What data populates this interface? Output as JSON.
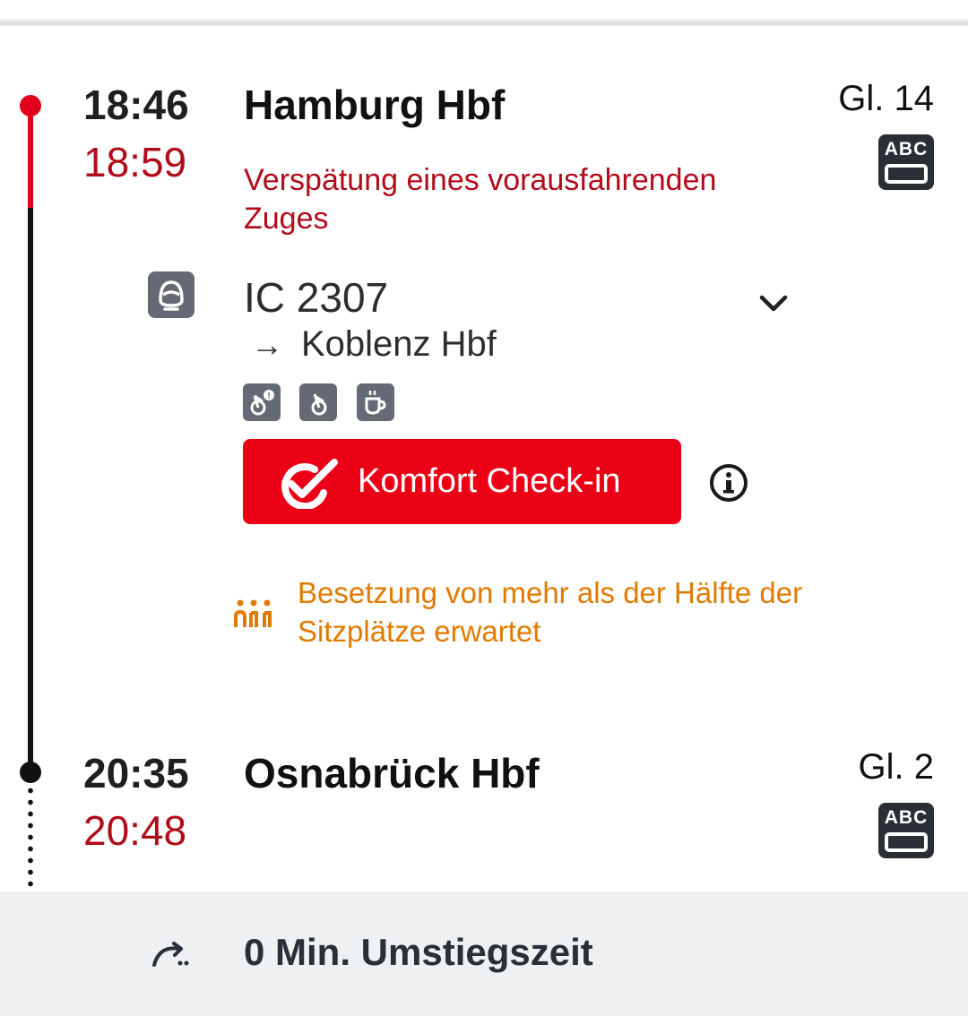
{
  "segment": {
    "departure": {
      "planned_time": "18:46",
      "actual_time": "18:59",
      "station": "Hamburg Hbf",
      "track": "Gl. 14",
      "delay_reason": "Verspätung eines vorausfahrenden Zuges",
      "platform_icon_text": "ABC"
    },
    "train": {
      "name": "IC 2307",
      "destination_arrow": "→",
      "destination": "Koblenz Hbf",
      "features": [
        "bike-reservation-required-icon",
        "bike-allowed-icon",
        "bistro-icon"
      ]
    },
    "checkin": {
      "label": "Komfort Check-in"
    },
    "occupancy": {
      "text": "Besetzung von mehr als der Hälfte der Sitzplätze erwartet"
    },
    "arrival": {
      "planned_time": "20:35",
      "actual_time": "20:48",
      "station": "Osnabrück Hbf",
      "track": "Gl. 2",
      "platform_icon_text": "ABC"
    }
  },
  "transfer": {
    "text": "0 Min. Umstiegszeit"
  },
  "colors": {
    "db_red": "#ec0016",
    "delay_red": "#b00c1a",
    "occupancy_orange": "#e07a00",
    "icon_gray": "#646973",
    "dark": "#2a2f36",
    "transfer_bg": "#eef0f2"
  }
}
